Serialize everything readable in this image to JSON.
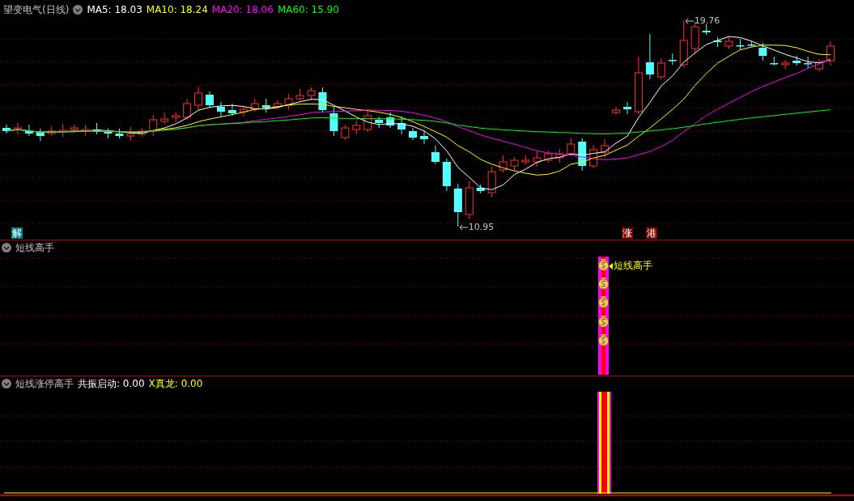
{
  "main_panel": {
    "title": "望变电气(日线)",
    "indicators": [
      {
        "label": "MA5: 18.03",
        "color": "#ffffff"
      },
      {
        "label": "MA10: 18.24",
        "color": "#ffff00"
      },
      {
        "label": "MA20: 18.06",
        "color": "#ff00ff"
      },
      {
        "label": "MA60: 15.90",
        "color": "#00ff00"
      }
    ],
    "high_label": "19.76",
    "low_label": "10.95",
    "signal_badges": [
      {
        "text": "解",
        "color": "#008080"
      },
      {
        "text": "涨",
        "color": "#800000"
      },
      {
        "text": "港",
        "color": "#800000"
      }
    ]
  },
  "panel_2": {
    "title": "短线高手",
    "signal_label": "短线高手"
  },
  "panel_3": {
    "title": "短线涨停高手",
    "readings": [
      {
        "label": "共振启动: 0.00",
        "color": "#ffffff"
      },
      {
        "label": "X真龙: 0.00",
        "color": "#ffff00"
      }
    ]
  }
}
